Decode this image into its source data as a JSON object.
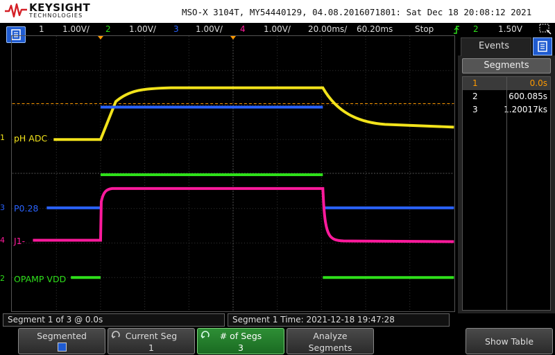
{
  "brand": {
    "name": "KEYSIGHT",
    "subtitle": "TECHNOLOGIES"
  },
  "device_info": "MSO-X 3104T, MY54440129, 04.08.2016071801: Sat Dec 18 20:08:12 2021",
  "status": {
    "ch1_num": "1",
    "ch1_scale": "1.00V/",
    "ch2_num": "2",
    "ch2_scale": "1.00V/",
    "ch3_num": "3",
    "ch3_scale": "1.00V/",
    "ch4_num": "4",
    "ch4_scale": "1.00V/",
    "timebase": "20.00ms/",
    "delay": "60.20ms",
    "run_state": "Stop",
    "trigger_source": "2",
    "trigger_level": "1.50V"
  },
  "colors": {
    "ch1": "#f2e31b",
    "ch2": "#2ee01a",
    "ch3": "#2a63ff",
    "ch4": "#ff1a9c",
    "accent_orange": "#ff9a00",
    "menu_blue": "#1f5bd1"
  },
  "traces": {
    "ch1_label": "pH ADC",
    "ch3_label": "P0.28",
    "ch4_label": "J1-",
    "ch2_label": "OPAMP VDD"
  },
  "marker_nums": {
    "ch1": "1",
    "ch3": "3",
    "ch4": "4",
    "ch2": "2"
  },
  "panel": {
    "events_tab": "Events",
    "segments_button": "Segments",
    "segments": [
      {
        "index": "1",
        "time": "0.0s"
      },
      {
        "index": "2",
        "time": "600.085s"
      },
      {
        "index": "3",
        "time": "1.20017ks"
      }
    ]
  },
  "info": {
    "segment_status": "Segment 1 of 3 @ 0.0s",
    "segment_time": "Segment 1 Time: 2021-12-18 19:47:28"
  },
  "softkeys": {
    "segmented": {
      "l1": "Segmented"
    },
    "current_seg": {
      "l1": "Current Seg",
      "l2": "1"
    },
    "num_segs": {
      "l1": "# of Segs",
      "l2": "3"
    },
    "analyze": {
      "l1": "Analyze",
      "l2": "Segments"
    },
    "show_table": {
      "l1": "Show Table"
    }
  },
  "icons": {
    "menu": "menu-icon",
    "back": "up-arrow-icon",
    "trigger": "trigger-edge-icon",
    "rotate": "rotate-knob-icon",
    "checkbox": "checkbox-icon",
    "zoom": "zoom-box-icon"
  }
}
